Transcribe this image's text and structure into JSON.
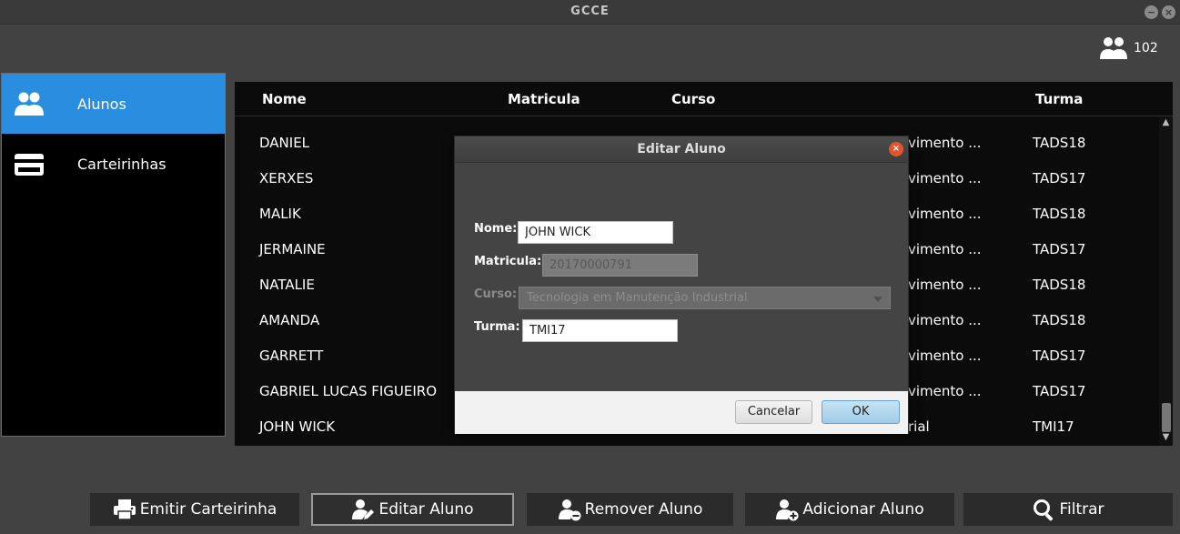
{
  "window": {
    "title": "GCCE",
    "minimize_glyph": "−",
    "close_glyph": "×"
  },
  "user_count": {
    "icon": "users-icon",
    "value": "102"
  },
  "sidebar": {
    "items": [
      {
        "label": "Alunos",
        "icon": "users-icon",
        "active": true
      },
      {
        "label": "Carteirinhas",
        "icon": "card-icon",
        "active": false
      }
    ]
  },
  "table": {
    "columns": [
      "Nome",
      "Matricula",
      "Curso",
      "Turma"
    ],
    "rows": [
      {
        "nome": "DANIEL",
        "curso": "vimento ...",
        "turma": "TADS18"
      },
      {
        "nome": "XERXES",
        "curso": "vimento ...",
        "turma": "TADS17"
      },
      {
        "nome": "MALIK",
        "curso": "vimento ...",
        "turma": "TADS18"
      },
      {
        "nome": "JERMAINE",
        "curso": "vimento ...",
        "turma": "TADS17"
      },
      {
        "nome": "NATALIE",
        "curso": "vimento ...",
        "turma": "TADS18"
      },
      {
        "nome": "AMANDA",
        "curso": "vimento ...",
        "turma": "TADS18"
      },
      {
        "nome": "GARRETT",
        "curso": "vimento ...",
        "turma": "TADS17"
      },
      {
        "nome": "GABRIEL LUCAS FIGUEIRO",
        "curso": "vimento ...",
        "turma": "TADS17"
      },
      {
        "nome": "JOHN WICK",
        "curso": "rial",
        "turma": "TMI17"
      }
    ],
    "scroll_up": "▲",
    "scroll_down": "▼"
  },
  "dialog": {
    "title": "Editar Aluno",
    "close_glyph": "×",
    "nome_label": "Nome:",
    "nome_value": "JOHN WICK",
    "matricula_label": "Matricula:",
    "matricula_value": "20170000791",
    "curso_label": "Curso:",
    "curso_value": "Tecnologia em Manutenção Industrial",
    "turma_label": "Turma:",
    "turma_value": "TMI17",
    "cancel_label": "Cancelar",
    "ok_label": "OK"
  },
  "actions": [
    {
      "label": "Emitir Carteirinha",
      "icon": "printer-icon"
    },
    {
      "label": "Editar Aluno",
      "icon": "edit-user-icon"
    },
    {
      "label": "Remover Aluno",
      "icon": "remove-user-icon"
    },
    {
      "label": "Adicionar Aluno",
      "icon": "add-user-icon"
    },
    {
      "label": "Filtrar",
      "icon": "search-icon"
    }
  ]
}
